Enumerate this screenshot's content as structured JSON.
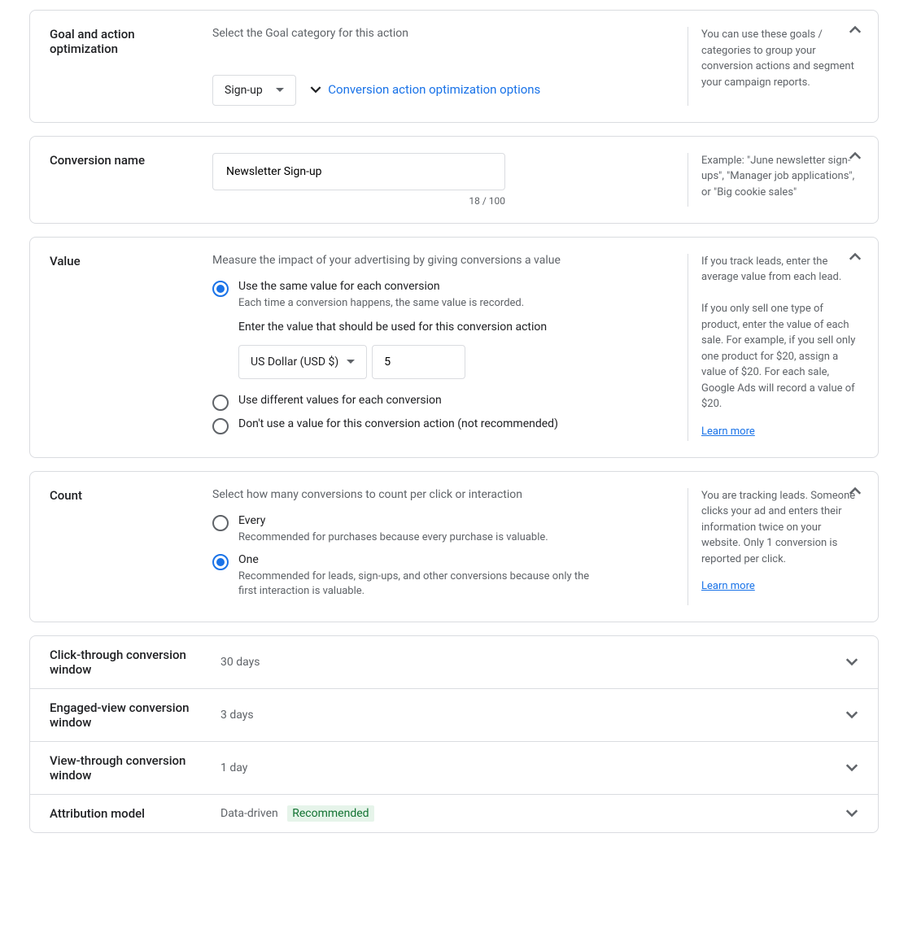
{
  "goal": {
    "title": "Goal and action optimization",
    "desc": "Select the Goal category for this action",
    "select_value": "Sign-up",
    "expand_link": "Conversion action optimization options",
    "help": "You can use these goals / categories to group your conversion actions and segment your campaign reports."
  },
  "name": {
    "title": "Conversion name",
    "value": "Newsletter Sign-up",
    "counter": "18 / 100",
    "help": "Example: \"June newsletter sign-ups\", \"Manager job applications\", or \"Big cookie sales\""
  },
  "value": {
    "title": "Value",
    "desc": "Measure the impact of your advertising by giving conversions a value",
    "opt1_label": "Use the same value for each conversion",
    "opt1_sub": "Each time a conversion happens, the same value is recorded.",
    "sub_label": "Enter the value that should be used for this conversion action",
    "currency": "US Dollar (USD $)",
    "amount": "5",
    "opt2_label": "Use different values for each conversion",
    "opt3_label": "Don't use a value for this conversion action (not recommended)",
    "help1": "If you track leads, enter the average value from each lead.",
    "help2": "If you only sell one type of product, enter the value of each sale. For example, if you sell only one product for $20, assign a value of $20. For each sale, Google Ads will record a value of $20.",
    "learn_more": "Learn more"
  },
  "count": {
    "title": "Count",
    "desc": "Select how many conversions to count per click or interaction",
    "opt1_label": "Every",
    "opt1_sub": "Recommended for purchases because every purchase is valuable.",
    "opt2_label": "One",
    "opt2_sub": "Recommended for leads, sign-ups, and other conversions because only the first interaction is valuable.",
    "help": "You are tracking leads. Someone clicks your ad and enters their information twice on your website. Only 1 conversion is reported per click.",
    "learn_more": "Learn more"
  },
  "collapsed": {
    "click_window": {
      "label": "Click-through conversion window",
      "value": "30 days"
    },
    "engaged_window": {
      "label": "Engaged-view conversion window",
      "value": "3 days"
    },
    "view_window": {
      "label": "View-through conversion window",
      "value": "1 day"
    },
    "attribution": {
      "label": "Attribution model",
      "value": "Data-driven",
      "badge": "Recommended"
    }
  }
}
